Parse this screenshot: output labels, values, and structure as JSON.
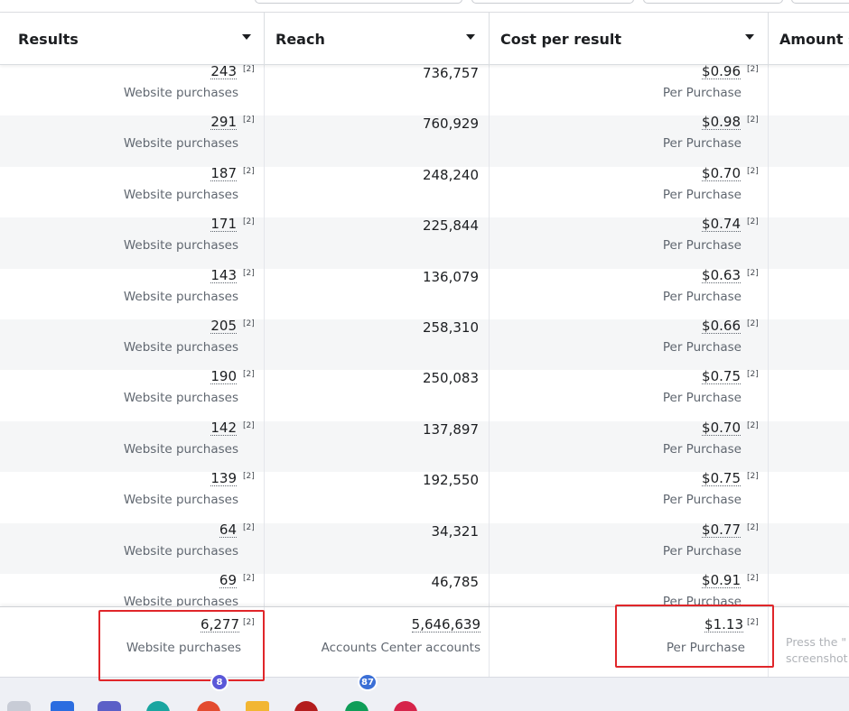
{
  "columns": {
    "results": "Results",
    "reach": "Reach",
    "cost_per_result": "Cost per result",
    "amount_spent": "Amount s"
  },
  "rows": [
    {
      "results": "243",
      "results_sub": "Website purchases",
      "reach": "736,757",
      "cost": "$0.96",
      "cost_sub": "Per Purchase"
    },
    {
      "results": "291",
      "results_sub": "Website purchases",
      "reach": "760,929",
      "cost": "$0.98",
      "cost_sub": "Per Purchase"
    },
    {
      "results": "187",
      "results_sub": "Website purchases",
      "reach": "248,240",
      "cost": "$0.70",
      "cost_sub": "Per Purchase"
    },
    {
      "results": "171",
      "results_sub": "Website purchases",
      "reach": "225,844",
      "cost": "$0.74",
      "cost_sub": "Per Purchase"
    },
    {
      "results": "143",
      "results_sub": "Website purchases",
      "reach": "136,079",
      "cost": "$0.63",
      "cost_sub": "Per Purchase"
    },
    {
      "results": "205",
      "results_sub": "Website purchases",
      "reach": "258,310",
      "cost": "$0.66",
      "cost_sub": "Per Purchase"
    },
    {
      "results": "190",
      "results_sub": "Website purchases",
      "reach": "250,083",
      "cost": "$0.75",
      "cost_sub": "Per Purchase"
    },
    {
      "results": "142",
      "results_sub": "Website purchases",
      "reach": "137,897",
      "cost": "$0.70",
      "cost_sub": "Per Purchase"
    },
    {
      "results": "139",
      "results_sub": "Website purchases",
      "reach": "192,550",
      "cost": "$0.75",
      "cost_sub": "Per Purchase"
    },
    {
      "results": "64",
      "results_sub": "Website purchases",
      "reach": "34,321",
      "cost": "$0.77",
      "cost_sub": "Per Purchase"
    },
    {
      "results": "69",
      "results_sub": "Website purchases",
      "reach": "46,785",
      "cost": "$0.91",
      "cost_sub": "Per Purchase"
    }
  ],
  "footnote_marker": "[2]",
  "totals": {
    "results": "6,277",
    "results_sub": "Website purchases",
    "reach": "5,646,639",
    "reach_sub": "Accounts Center accounts",
    "cost": "$1.13",
    "cost_sub": "Per Purchase"
  },
  "hint": {
    "line1": "Press the \"",
    "line2": "screenshot"
  },
  "taskbar": {
    "badges": [
      "8",
      "87"
    ]
  },
  "colors": {
    "highlight_border": "#e0262a",
    "row_alt_bg": "#f5f6f7",
    "divider": "#dadde1"
  }
}
